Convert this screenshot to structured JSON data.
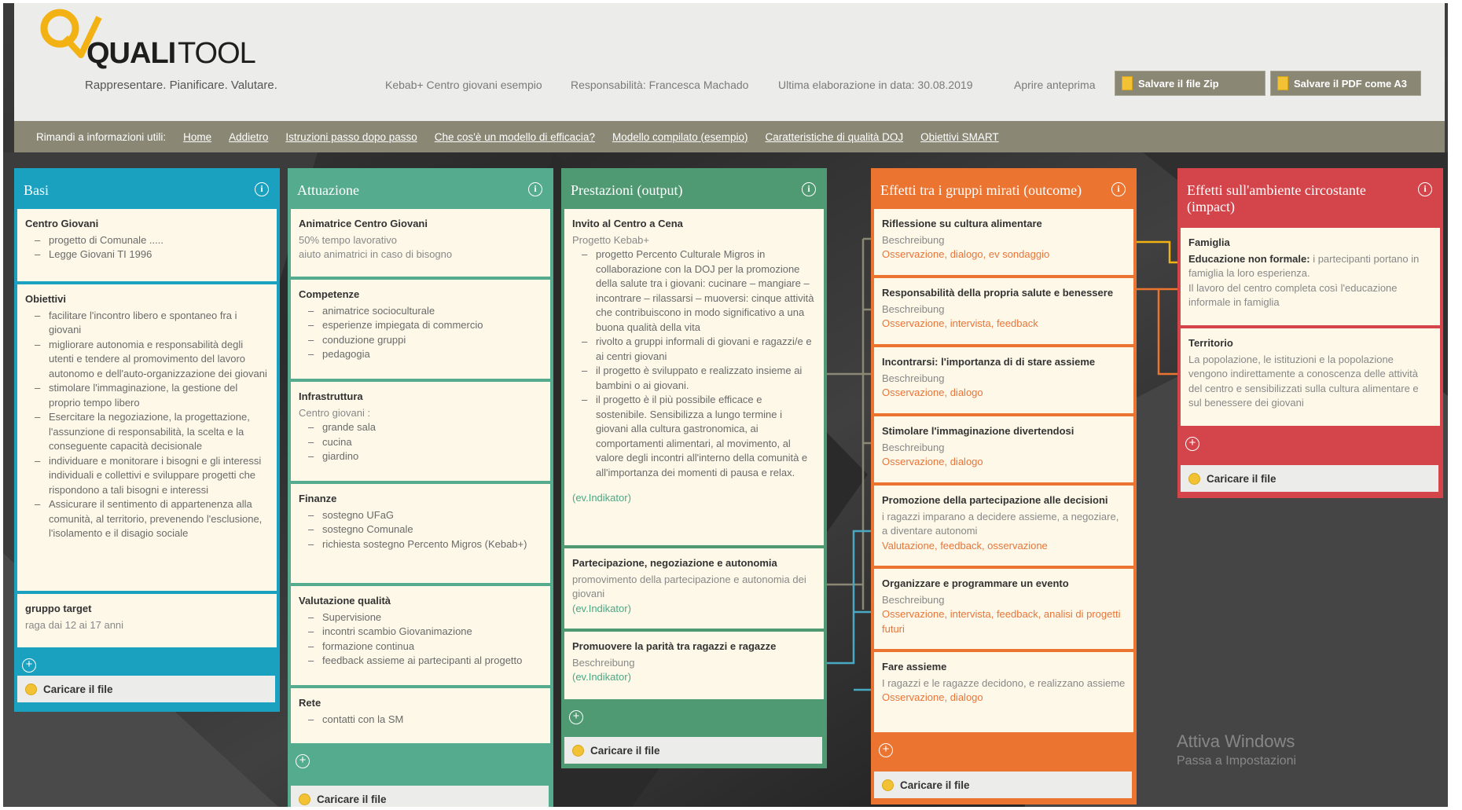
{
  "app": {
    "tagline": "Rappresentare. Pianificare. Valutare."
  },
  "header": {
    "project": "Kebab+ Centro giovani esempio",
    "responsible": "Responsabilità: Francesca Machado",
    "last_edit": "Ultima elaborazione in data: 30.08.2019",
    "preview": "Aprire anteprima",
    "save_zip": "Salvare il file Zip",
    "save_pdf": "Salvare il PDF come A3"
  },
  "nav": {
    "label": "Rimandi a informazioni utili:",
    "links": [
      "Home",
      "Addietro",
      "Istruzioni passo dopo passo",
      "Che cos'è un modello di efficacia?",
      "Modello compilato (esempio)",
      "Caratteristiche di qualità DOJ",
      "Obiettivi SMART"
    ]
  },
  "colors": {
    "basi": "#1aa1c0",
    "attuazione": "#55ab8d",
    "prestazioni": "#4f9a73",
    "outcome": "#ec7431",
    "impact": "#d3454a"
  },
  "upload_label": "Caricare il file",
  "columns": {
    "basi": {
      "title": "Basi",
      "cards": [
        {
          "title": "Centro Giovani",
          "items": [
            "progetto di Comunale .....",
            "Legge Giovani TI 1996"
          ]
        },
        {
          "title": "Obiettivi",
          "items": [
            "facilitare l'incontro libero e spontaneo fra i giovani",
            "migliorare autonomia e responsabilità degli utenti e tendere al promovimento del lavoro autonomo e dell'auto-organizzazione dei giovani",
            "stimolare l'immaginazione, la gestione del proprio tempo libero",
            "Esercitare la negoziazione, la progettazione, l'assunzione di responsabilità, la scelta e la conseguente capacità decisionale",
            "individuare e monitorare i bisogni e gli interessi individuali e collettivi e sviluppare progetti che rispondono a tali bisogni e interessi",
            "Assicurare il sentimento di appartenenza alla comunità, al territorio, prevenendo l'esclusione, l'isolamento e il disagio sociale"
          ]
        },
        {
          "title": "gruppo target",
          "text": "raga dai 12 ai 17 anni"
        }
      ]
    },
    "attuazione": {
      "title": "Attuazione",
      "cards": [
        {
          "title": "Animatrice Centro Giovani",
          "text": "50% tempo lavorativo",
          "text2": "aiuto animatrici in caso di bisogno"
        },
        {
          "title": "Competenze",
          "items": [
            "animatrice socioculturale",
            "esperienze impiegata di commercio",
            "conduzione gruppi",
            "pedagogia"
          ]
        },
        {
          "title": "Infrastruttura",
          "text": "Centro giovani :",
          "items": [
            "grande sala",
            "cucina",
            "giardino"
          ]
        },
        {
          "title": "Finanze",
          "items": [
            "sostegno UFaG",
            "sostegno Comunale",
            "richiesta sostegno Percento Migros (Kebab+)"
          ]
        },
        {
          "title": "Valutazione qualità",
          "items": [
            "Supervisione",
            "incontri scambio Giovanimazione",
            "formazione continua",
            "feedback assieme ai partecipanti al progetto"
          ]
        },
        {
          "title": "Rete",
          "items": [
            "contatti con la SM"
          ]
        }
      ]
    },
    "prestazioni": {
      "title": "Prestazioni (output)",
      "cards": [
        {
          "title": "Invito al Centro a Cena",
          "text": "Progetto Kebab+",
          "items": [
            "progetto Percento Culturale Migros in collaborazione con la DOJ per la promozione della salute tra i giovani: cucinare – mangiare – incontrare – rilassarsi – muoversi: cinque attività che contribuiscono in modo significativo a una buona qualità della vita",
            "rivolto a gruppi informali di giovani e ragazzi/e e ai centri giovani",
            "il progetto è sviluppato e realizzato insieme ai bambini o ai giovani.",
            "il progetto è il più possibile efficace e sostenibile. Sensibilizza a lungo termine i giovani alla cultura gastronomica, ai comportamenti alimentari, al movimento, al valore degli incontri all'interno della comunità e all'importanza dei momenti di pausa e relax."
          ],
          "ind": "(ev.Indikator)"
        },
        {
          "title": "Partecipazione, negoziazione e autonomia",
          "text": "promovimento della partecipazione e autonomia dei giovani",
          "ind": "(ev.Indikator)"
        },
        {
          "title": "Promuovere la parità tra ragazzi e ragazze",
          "text": "Beschreibung",
          "ind": "(ev.Indikator)"
        }
      ]
    },
    "outcome": {
      "title": "Effetti tra i gruppi mirati (outcome)",
      "cards": [
        {
          "title": "Riflessione su cultura alimentare",
          "text": "Beschreibung",
          "obs": "Osservazione, dialogo, ev sondaggio"
        },
        {
          "title": "Responsabilità della propria salute e benessere",
          "text": "Beschreibung",
          "obs": "Osservazione, intervista, feedback"
        },
        {
          "title": "Incontrarsi: l'importanza di di stare assieme",
          "text": "Beschreibung",
          "obs": "Osservazione, dialogo"
        },
        {
          "title": "Stimolare l'immaginazione divertendosi",
          "text": "Beschreibung",
          "obs": "Osservazione, dialogo"
        },
        {
          "title": "Promozione della partecipazione alle decisioni",
          "text": "i ragazzi imparano a decidere assieme, a negoziare, a diventare autonomi",
          "obs": "Valutazione, feedback, osservazione"
        },
        {
          "title": "Organizzare e programmare un evento",
          "text": "Beschreibung",
          "obs": "Osservazione, intervista, feedback, analisi di progetti futuri"
        },
        {
          "title": "Fare assieme",
          "text": "I ragazzi e le ragazze decidono, e realizzano assieme",
          "obs": "Osservazione, dialogo"
        }
      ]
    },
    "impact": {
      "title": "Effetti sull'ambiente circostante (impact)",
      "cards": [
        {
          "title": "Famiglia",
          "bold": "Educazione non formale:",
          "text": "i partecipanti portano in famiglia la loro esperienza.",
          "text2": "Il lavoro del centro completa così l'educazione informale in famiglia"
        },
        {
          "title": "Territorio",
          "text": "La popolazione, le istituzioni e la popolazione vengono indirettamente a conoscenza delle attività del centro e sensibilizzati sulla cultura alimentare e sul benessere dei giovani"
        }
      ]
    }
  },
  "watermark": {
    "line1": "Attiva Windows",
    "line2": "Passa a Impostazioni"
  }
}
